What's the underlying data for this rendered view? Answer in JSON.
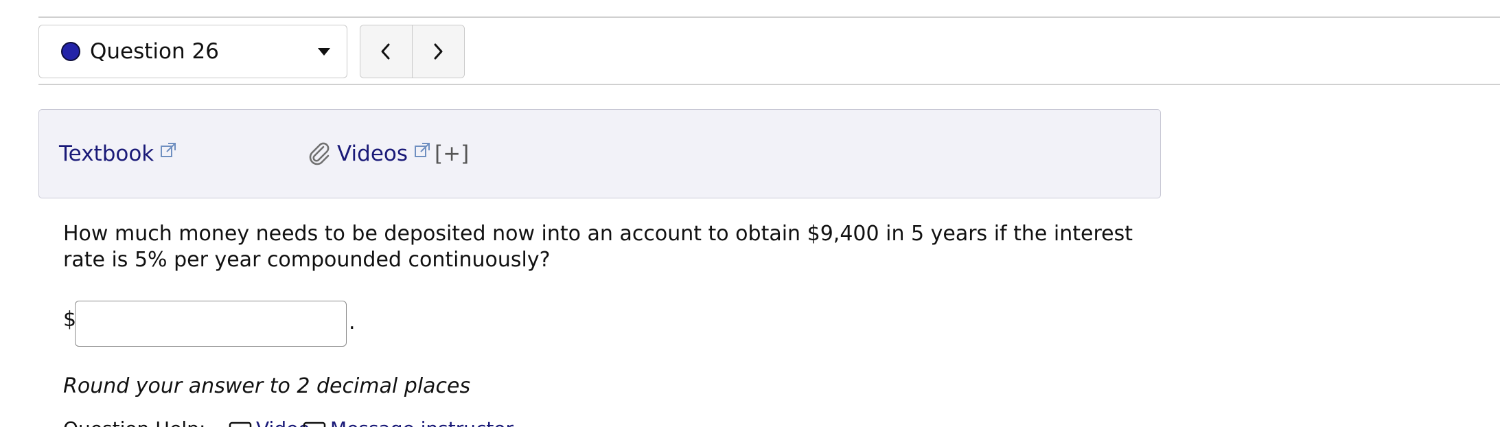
{
  "question_nav": {
    "selected": "Question 26",
    "status_color": "#2323a8",
    "dropdown_icon": "caret-down-icon",
    "prev_icon": "chevron-left-icon",
    "next_icon": "chevron-right-icon"
  },
  "help": {
    "textbook_label": "Textbook",
    "videos_label": "Videos",
    "expand_label": "[+]",
    "link_color": "#1a1a78",
    "link_icon": "external-link-icon",
    "attachment_icon": "paperclip-icon"
  },
  "question": {
    "text": "How much money needs to be deposited now into an account to obtain $9,400 in 5 years if the interest rate is 5% per year compounded continuously?",
    "currency_symbol": "$",
    "answer_value": "",
    "answer_suffix": ".",
    "instruction": "Round your answer to 2 decimal places"
  },
  "question_help": {
    "label": "Question Help:",
    "video_label": "Video",
    "message_label": "Message instructor"
  }
}
